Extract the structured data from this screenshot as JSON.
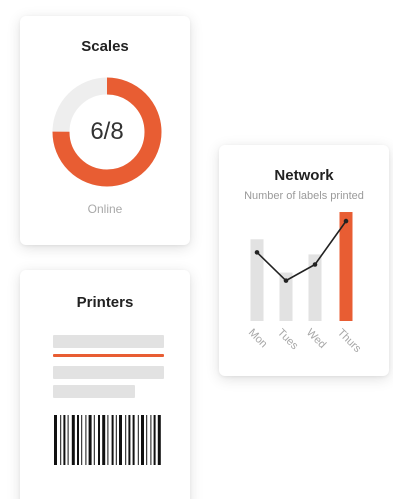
{
  "colors": {
    "accent": "#e85d33",
    "bar_gray": "#e2e2e2",
    "track_gray": "#eeeeee"
  },
  "scales": {
    "title": "Scales",
    "progress_text": "6/8",
    "online": 6,
    "total": 8,
    "status": "Online"
  },
  "network": {
    "title": "Network",
    "subtitle": "Number of labels printed"
  },
  "printers": {
    "title": "Printers",
    "label_lines": [
      "gray",
      "accent",
      "gray",
      "gray"
    ],
    "barcode_icon": "barcode-icon"
  },
  "chart_data": {
    "type": "bar",
    "categories": [
      "Mon",
      "Tues",
      "Wed",
      "Thurs"
    ],
    "series": [
      {
        "values": [
          81,
          48,
          66,
          108
        ]
      },
      {
        "values": [
          68,
          40,
          56,
          99
        ]
      }
    ],
    "highlight_index": 3,
    "ylim": [
      0,
      110
    ],
    "grid": false
  }
}
